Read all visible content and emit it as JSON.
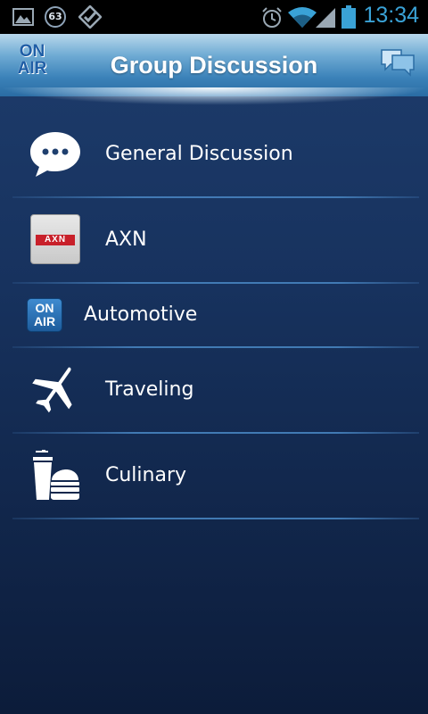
{
  "status_bar": {
    "notification_count": "63",
    "time": "13:34",
    "icons": [
      "image-icon",
      "notification-count-icon",
      "app-icon",
      "alarm-icon",
      "wifi-icon",
      "signal-icon",
      "battery-icon"
    ]
  },
  "header": {
    "title": "Group Discussion",
    "logo_top": "ON",
    "logo_bottom": "AIR"
  },
  "list": {
    "items": [
      {
        "label": "General Discussion",
        "icon": "speech-bubble-icon"
      },
      {
        "label": "AXN",
        "icon": "axn-logo-icon"
      },
      {
        "label": "Automotive",
        "icon": "on-air-logo-icon"
      },
      {
        "label": "Traveling",
        "icon": "airplane-icon"
      },
      {
        "label": "Culinary",
        "icon": "food-drink-icon"
      }
    ]
  },
  "axn_logo_text": "AXN",
  "onair_small": {
    "top": "ON",
    "bottom": "AIR"
  },
  "colors": {
    "accent": "#3aa2d6",
    "header": "#3b82b9",
    "background": "#17325e"
  }
}
